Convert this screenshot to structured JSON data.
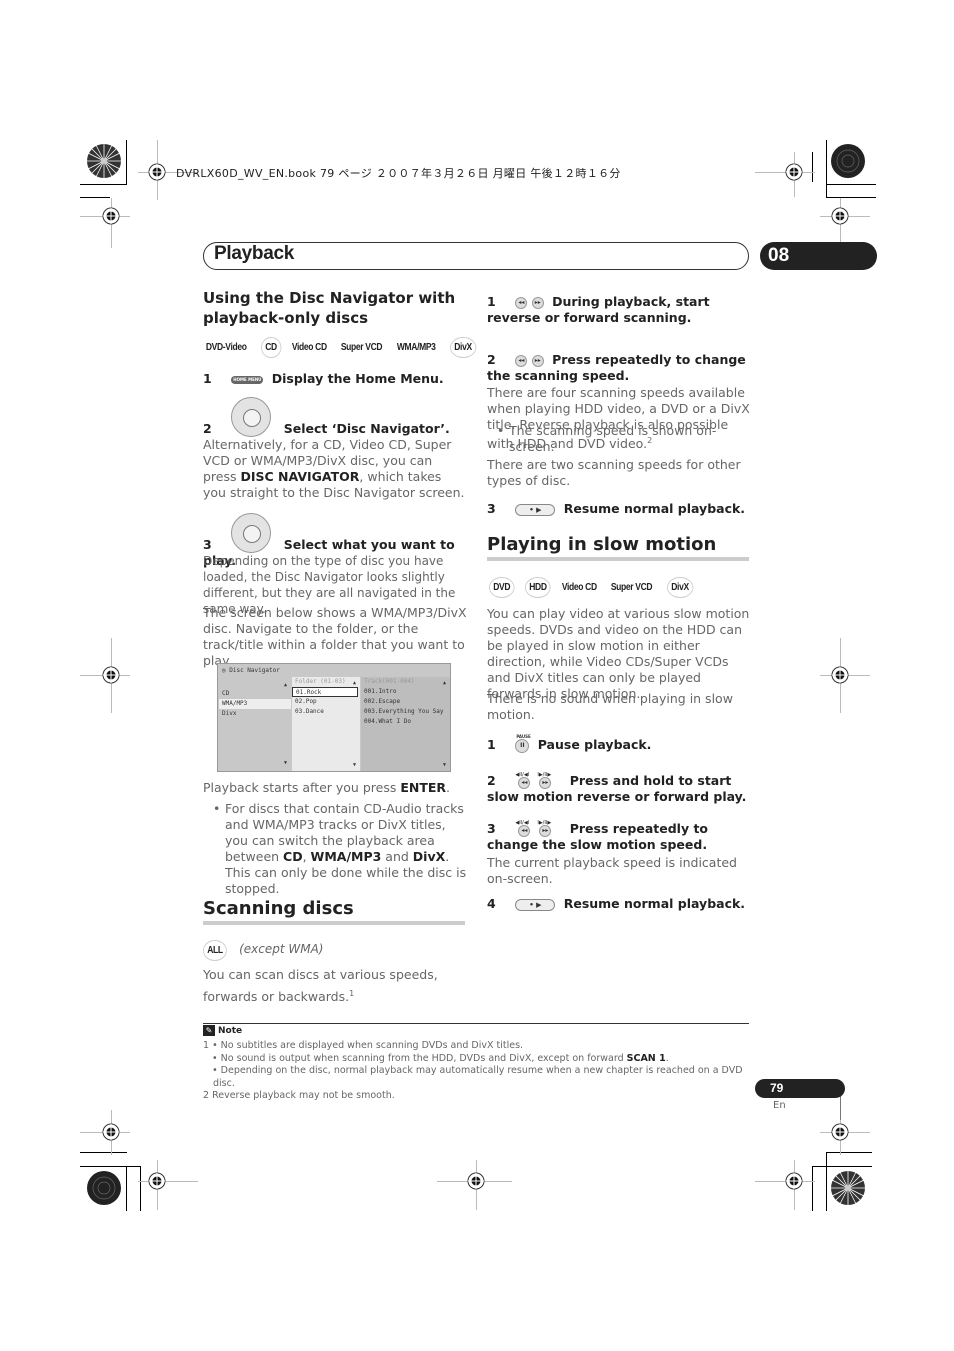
{
  "print_header": "DVRLX60D_WV_EN.book  79 ページ  ２００７年３月２６日  月曜日  午後１２時１６分",
  "chapter": {
    "title": "Playback",
    "number": "08"
  },
  "left": {
    "section1": {
      "heading": "Using the Disc Navigator with playback-only discs",
      "badges": [
        "DVD-Video",
        "CD",
        "Video CD",
        "Super VCD",
        "WMA/MP3",
        "DivX"
      ],
      "step1": {
        "num": "1",
        "icon": "home-menu-button",
        "icon_text": "HOME MENU",
        "label": "Display the Home Menu."
      },
      "step2": {
        "num": "2",
        "icon": "joystick",
        "label": "Select ‘Disc Navigator’."
      },
      "step2_text_a": "Alternatively, for a CD, Video CD, Super VCD or WMA/MP3/DivX disc, you can press ",
      "step2_text_bold": "DISC NAVIGATOR",
      "step2_text_b": ", which takes you straight to the Disc Navigator screen.",
      "step3": {
        "num": "3",
        "icon": "joystick",
        "label": "Select what you want to play."
      },
      "step3_text": "Depending on the type of disc you have loaded, the Disc Navigator looks slightly different, but they are all navigated in the same way.",
      "screen_text": "The screen below shows a WMA/MP3/DivX disc. Navigate to the folder, or the track/title within a folder that you want to play.",
      "disc_navigator": {
        "title": "Disc Navigator",
        "types": [
          "CD",
          "WMA/MP3",
          "Divx"
        ],
        "selected_type": "WMA/MP3",
        "folder_header": "Folder (01-03)",
        "folders": [
          "01.Rock",
          "02.Pop",
          "03.Dance"
        ],
        "current_folder": "01.Rock",
        "track_header": "Track(001-004)",
        "tracks": [
          "001.Intro",
          "002.Escape",
          "003.Everything You Say",
          "004.What I Do"
        ]
      },
      "after_text_a": "Playback starts after you press ",
      "after_text_bold": "ENTER",
      "after_text_b": ".",
      "bullet": {
        "a": "For discs that contain CD-Audio tracks and WMA/MP3 tracks or DivX titles, you can switch the playback area between ",
        "b1": "CD",
        "sep1": ", ",
        "b2": "WMA/MP3",
        "sep2": " and ",
        "b3": "DivX",
        "c": ". This can only be done while the disc is stopped."
      }
    },
    "section2": {
      "heading": "Scanning discs",
      "badge": "ALL",
      "badge_note": "(except WMA)",
      "intro": "You can scan discs at various speeds, forwards or backwards.",
      "intro_sup": "1"
    }
  },
  "right": {
    "scan_steps": {
      "step1": {
        "num": "1",
        "label": "During playback, start reverse or forward scanning."
      },
      "step1_bullet": "The scanning speed is shown on-screen.",
      "step2": {
        "num": "2",
        "label": "Press repeatedly to change the scanning speed."
      },
      "step2_text": "There are four scanning speeds available when playing HDD video, a DVD or a DivX title. Reverse playback is also possible with HDD and DVD video.",
      "step2_sup": "2",
      "step2_text2": "There are two scanning speeds for other types of disc.",
      "step3": {
        "num": "3",
        "label": "Resume normal playback."
      }
    },
    "slow": {
      "heading": "Playing in slow motion",
      "badges": [
        "DVD",
        "HDD",
        "Video CD",
        "Super VCD",
        "DivX"
      ],
      "text1": "You can play video at various slow motion speeds. DVDs and video on the HDD can be played in slow motion in either direction, while Video CDs/Super VCDs and DivX titles can only be played forwards in slow motion.",
      "text2": "There is no sound when playing in slow motion.",
      "step1": {
        "num": "1",
        "icon_caption": "PAUSE",
        "label": "Pause playback."
      },
      "step2": {
        "num": "2",
        "label": "Press and hold to start slow motion reverse or forward play."
      },
      "step3": {
        "num": "3",
        "label": "Press repeatedly to change the slow motion speed."
      },
      "step3_text": "The current playback speed is indicated on-screen.",
      "step4": {
        "num": "4",
        "label": "Resume normal playback."
      },
      "slow_icon_caption_left": "◀II/◀I",
      "slow_icon_caption_right": "I▶/II▶"
    }
  },
  "notes": {
    "title": "Note",
    "n1_a": "1 • No subtitles are displayed when scanning DVDs and DivX titles.",
    "n1_b_a": "   • No sound is output when scanning from the HDD, DVDs and DivX, except on forward ",
    "n1_b_bold": "SCAN 1",
    "n1_b_c": ".",
    "n1_c": "   • Depending on the disc, normal playback may automatically resume when a new chapter is reached on a DVD disc.",
    "n2": "2 Reverse playback may not be smooth."
  },
  "page": {
    "number": "79",
    "lang": "En"
  }
}
